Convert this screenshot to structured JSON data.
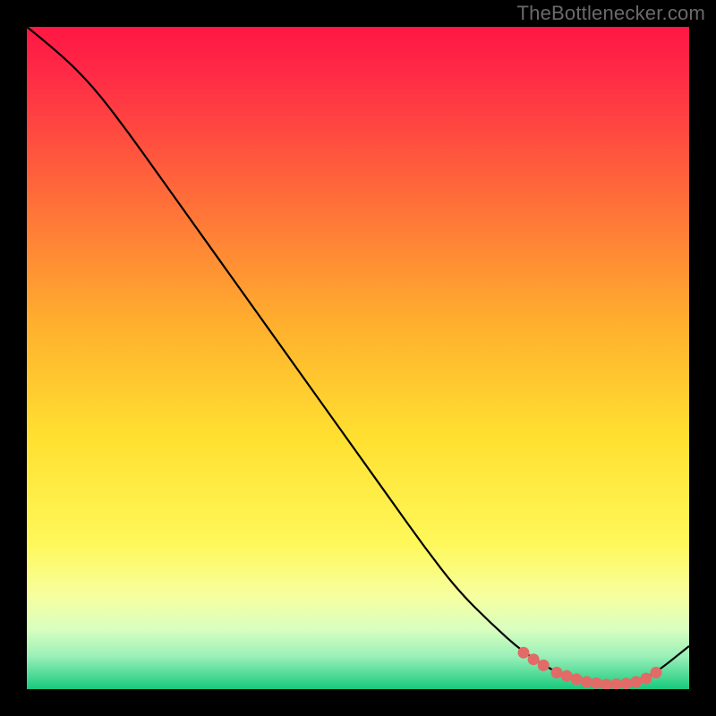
{
  "attribution": "TheBottlenecker.com",
  "chart_data": {
    "type": "line",
    "title": "",
    "xlabel": "",
    "ylabel": "",
    "xlim": [
      0,
      100
    ],
    "ylim": [
      0,
      100
    ],
    "series": [
      {
        "name": "curve",
        "x": [
          0,
          5,
          10,
          15,
          20,
          25,
          30,
          35,
          40,
          45,
          50,
          55,
          60,
          65,
          70,
          75,
          80,
          82.5,
          85,
          87.5,
          90,
          92.5,
          95,
          100
        ],
        "y": [
          100,
          96,
          91,
          84.5,
          77.5,
          70.5,
          63.5,
          56.5,
          49.5,
          42.5,
          35.5,
          28.5,
          21.5,
          15,
          10,
          5.5,
          2.5,
          1.4,
          0.9,
          0.7,
          0.8,
          1.3,
          2.5,
          6.5
        ]
      }
    ],
    "markers": {
      "comment": "salmon dotted markers near the trough",
      "x": [
        75,
        76.5,
        78,
        80,
        81.5,
        83,
        84.5,
        86,
        87.5,
        89,
        90.5,
        92,
        93.5,
        95
      ],
      "y": [
        5.5,
        4.5,
        3.6,
        2.5,
        2.0,
        1.5,
        1.1,
        0.9,
        0.7,
        0.75,
        0.85,
        1.1,
        1.6,
        2.5
      ]
    },
    "gradient_stops": [
      {
        "offset": 0.0,
        "color": "#ff1744"
      },
      {
        "offset": 0.07,
        "color": "#ff2a46"
      },
      {
        "offset": 0.25,
        "color": "#ff6a3a"
      },
      {
        "offset": 0.45,
        "color": "#ffb02e"
      },
      {
        "offset": 0.62,
        "color": "#ffe030"
      },
      {
        "offset": 0.78,
        "color": "#fff85a"
      },
      {
        "offset": 0.86,
        "color": "#f6ffa0"
      },
      {
        "offset": 0.91,
        "color": "#d8ffc0"
      },
      {
        "offset": 0.95,
        "color": "#9bf0b8"
      },
      {
        "offset": 0.985,
        "color": "#3fd68f"
      },
      {
        "offset": 1.0,
        "color": "#18c87e"
      }
    ],
    "marker_color": "#e26a67",
    "line_color": "#000000"
  }
}
